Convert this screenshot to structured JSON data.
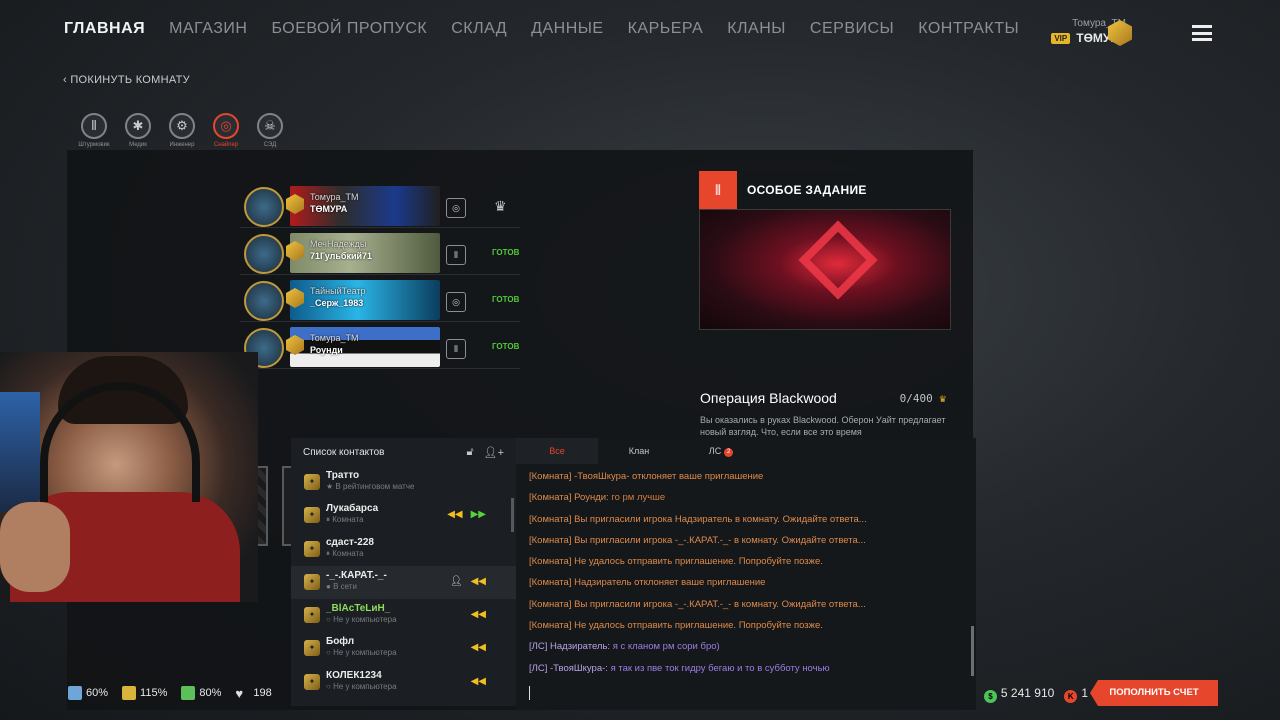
{
  "nav": {
    "items": [
      "ГЛАВНАЯ",
      "МАГАЗИН",
      "БОЕВОЙ ПРОПУСК",
      "СКЛАД",
      "ДАННЫЕ",
      "КАРЬЕРА",
      "КЛАНЫ",
      "СЕРВИСЫ",
      "КОНТРАКТЫ"
    ],
    "active": "ГЛАВНАЯ"
  },
  "user": {
    "clan": "Томура_ТМ",
    "vip": "VIP",
    "name": "ТӨМУРА"
  },
  "leave_room": "‹ ПОКИНУТЬ КОМНАТУ",
  "classes": [
    {
      "label": "Штурмовик",
      "icon": "rifle-ammo-icon",
      "glyph": "⦀"
    },
    {
      "label": "Медик",
      "icon": "medic-icon",
      "glyph": "✱"
    },
    {
      "label": "Инженер",
      "icon": "engineer-icon",
      "glyph": "⚙"
    },
    {
      "label": "Снайпер",
      "icon": "sniper-crosshair-icon",
      "glyph": "◎",
      "selected": true
    },
    {
      "label": "СЭД",
      "icon": "skull-icon",
      "glyph": "☠"
    }
  ],
  "squad": [
    {
      "clan": "Томура_ТМ",
      "name": "ТӨМУРА",
      "class_glyph": "◎",
      "status": "",
      "leader": true,
      "banner": "linear-gradient(90deg,#b01b1b 0%,#2d2d2d 35%,#1b3a8c 70%,#202020 100%)"
    },
    {
      "clan": "МечНадежды",
      "name": "71Гульбкий71",
      "class_glyph": "⦀",
      "status": "ГОТОВ",
      "leader": false,
      "banner": "linear-gradient(90deg,#7e8a68 0%,#a7b08f 40%,#4f5a3e 100%)"
    },
    {
      "clan": "ТайныйТеатр",
      "name": "_Серж_1983",
      "class_glyph": "◎",
      "status": "ГОТОВ",
      "leader": false,
      "banner": "linear-gradient(90deg,#0e5b8c 0%,#2ab5e6 45%,#0b3d5e 100%)"
    },
    {
      "clan": "Томура_ТМ",
      "name": "Роунди",
      "class_glyph": "⦀",
      "status": "ГОТОВ",
      "leader": false,
      "banner": "linear-gradient(180deg,#3d6fc9 0%,#3d6fc9 33%,#111 33%,#111 66%,#eee 66%,#eee 100%)"
    }
  ],
  "mission": {
    "header": "ОСОБОЕ ЗАДАНИЕ",
    "name": "Операция Blackwood",
    "progress": "0/400",
    "description": "Вы оказались в руках Blackwood. Оберон Уайт предлагает новый взгляд. Что, если все это время"
  },
  "contacts": {
    "title": "Список контактов",
    "items": [
      {
        "name": "Тратто",
        "status": "В рейтинговом матче",
        "status_marker": "★",
        "green": false,
        "actions": []
      },
      {
        "name": "Лукабарса",
        "status": "Комната",
        "status_marker": "⏸",
        "green": false,
        "actions": [
          "invite",
          "join"
        ]
      },
      {
        "name": "сдаст-228",
        "status": "Комната",
        "status_marker": "⏸",
        "green": false,
        "actions": []
      },
      {
        "name": "-_-.КАРАТ.-_-",
        "status": "В сети",
        "status_marker": "●",
        "green": false,
        "actions": [
          "profile",
          "invite"
        ],
        "highlighted": true
      },
      {
        "name": "_BlAcTeLиH_",
        "status": "Не у компьютера",
        "status_marker": "○",
        "green": true,
        "actions": [
          "invite"
        ]
      },
      {
        "name": "Бофл",
        "status": "Не у компьютера",
        "status_marker": "○",
        "green": false,
        "actions": [
          "invite"
        ]
      },
      {
        "name": "КОЛЕК1234",
        "status": "Не у компьютера",
        "status_marker": "○",
        "green": false,
        "actions": [
          "invite"
        ]
      }
    ]
  },
  "chat": {
    "tabs": [
      {
        "label": "Все",
        "active": true
      },
      {
        "label": "Клан"
      },
      {
        "label": "ЛС",
        "badge": "2"
      }
    ],
    "lines": [
      {
        "type": "room",
        "text": "[Комната] -ТвояШкура- отклоняет ваше приглашение"
      },
      {
        "type": "room_msg",
        "prefix": "[Комната] Роунди: ",
        "text": "го рм лучше"
      },
      {
        "type": "room",
        "text": "[Комната] Вы пригласили игрока Надзиратель в комнату. Ожидайте ответа..."
      },
      {
        "type": "room",
        "text": "[Комната] Вы пригласили игрока -_-.КАРАТ.-_- в комнату. Ожидайте ответа..."
      },
      {
        "type": "room",
        "text": "[Комната] Не удалось отправить приглашение. Попробуйте позже."
      },
      {
        "type": "room",
        "text": "[Комната] Надзиратель отклоняет ваше приглашение"
      },
      {
        "type": "room",
        "text": "[Комната] Вы пригласили игрока -_-.КАРАТ.-_- в комнату. Ожидайте ответа..."
      },
      {
        "type": "room",
        "text": "[Комната] Не удалось отправить приглашение. Попробуйте позже."
      },
      {
        "type": "pm",
        "prefix": "[ЛС] Надзиратель: ",
        "text": "я с кланом рм сори бро)"
      },
      {
        "type": "pm",
        "prefix": "[ЛС] -ТвояШкура-: ",
        "text": "я так из пве ток гидру бегаю и то в субботу ночью"
      }
    ]
  },
  "stats": [
    {
      "value": "60%",
      "color": "#6fa6d8",
      "icon": "boost-xp-icon"
    },
    {
      "value": "115%",
      "color": "#d8b53a",
      "icon": "boost-money-icon"
    },
    {
      "value": "80%",
      "color": "#5bbf5a",
      "icon": "boost-vp-icon"
    },
    {
      "value": "198",
      "color": "#e0e0e0",
      "icon": "heart-icon"
    }
  ],
  "currency": {
    "money": "5 241 910",
    "kredits": "1",
    "money_color": "#4bc45a",
    "kredits_color": "#e6462c"
  },
  "topup_label": "ПОПОЛНИТЬ СЧЕТ",
  "colors": {
    "accent": "#e6462c",
    "ready": "#52c93a",
    "invite": "#f2c01c"
  }
}
